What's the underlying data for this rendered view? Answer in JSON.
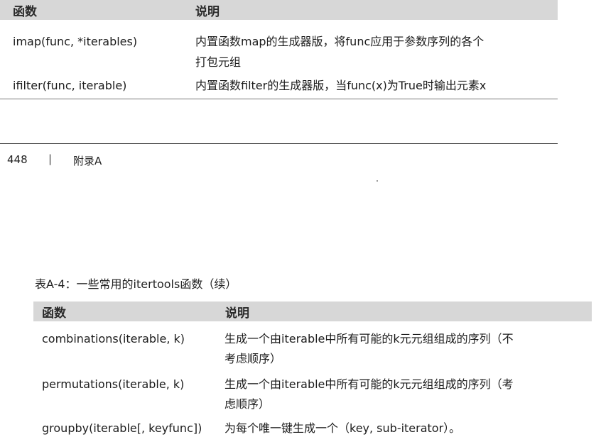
{
  "top_table": {
    "header": {
      "col1": "函数",
      "col2": "说明"
    },
    "rows": [
      {
        "func": "imap(func, *iterables)",
        "desc_lines": [
          "内置函数map的生成器版，将func应用于参数序列的各个",
          "打包元组"
        ]
      },
      {
        "func": "ifilter(func, iterable)",
        "desc_lines": [
          "内置函数filter的生成器版，当func(x)为True时输出元素x"
        ]
      }
    ]
  },
  "footer": {
    "page_number": "448",
    "separator": "|",
    "section": "附录A"
  },
  "caption": "表A-4：一些常用的itertools函数（续）",
  "bottom_table": {
    "header": {
      "col1": "函数",
      "col2": "说明"
    },
    "rows": [
      {
        "func": "combinations(iterable, k)",
        "desc_lines": [
          "生成一个由iterable中所有可能的k元元组组成的序列（不",
          "考虑顺序）"
        ]
      },
      {
        "func": "permutations(iterable, k)",
        "desc_lines": [
          "生成一个由iterable中所有可能的k元元组组成的序列（考",
          "虑顺序）"
        ]
      },
      {
        "func": "groupby(iterable[, keyfunc])",
        "desc_lines": [
          "为每个唯一键生成一个（key, sub-iterator）。"
        ]
      }
    ]
  }
}
